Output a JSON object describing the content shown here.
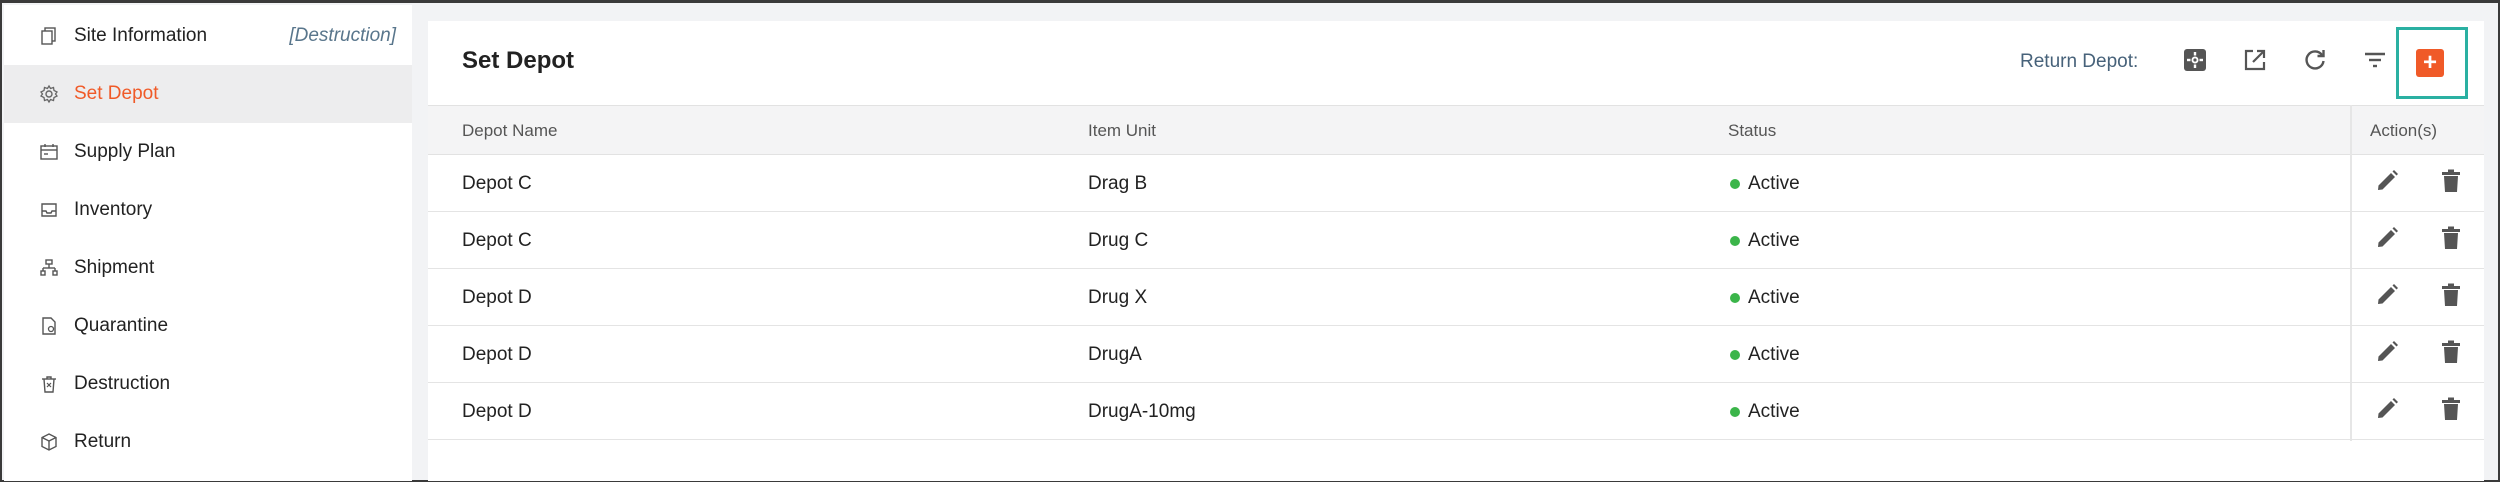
{
  "sidebar": {
    "items": [
      {
        "label": "Site Information",
        "icon": "document-copy-icon",
        "tag": "[Destruction]",
        "active": false
      },
      {
        "label": "Set Depot",
        "icon": "gear-icon",
        "active": true
      },
      {
        "label": "Supply Plan",
        "icon": "calendar-icon",
        "active": false
      },
      {
        "label": "Inventory",
        "icon": "inbox-icon",
        "active": false
      },
      {
        "label": "Shipment",
        "icon": "hierarchy-icon",
        "active": false
      },
      {
        "label": "Quarantine",
        "icon": "document-lock-icon",
        "active": false
      },
      {
        "label": "Destruction",
        "icon": "trash-icon",
        "active": false
      },
      {
        "label": "Return",
        "icon": "box-icon",
        "active": false
      }
    ]
  },
  "header": {
    "title": "Set Depot",
    "return_depot_label": "Return Depot:",
    "tools": [
      "settings-icon",
      "external-link-icon",
      "refresh-icon",
      "filter-icon",
      "add-icon"
    ],
    "add_symbol": "+"
  },
  "table": {
    "columns": [
      "Depot Name",
      "Item Unit",
      "Status",
      "Action(s)"
    ],
    "rows": [
      {
        "depot": "Depot C",
        "item": "Drag B",
        "status": "Active"
      },
      {
        "depot": "Depot C",
        "item": "Drug C",
        "status": "Active"
      },
      {
        "depot": "Depot D",
        "item": "Drug X",
        "status": "Active"
      },
      {
        "depot": "Depot D",
        "item": "DrugA",
        "status": "Active"
      },
      {
        "depot": "Depot D",
        "item": "DrugA-10mg",
        "status": "Active"
      }
    ]
  },
  "colors": {
    "accent": "#f05a28",
    "status_active": "#3bb54a",
    "highlight": "#2ab0a2"
  }
}
